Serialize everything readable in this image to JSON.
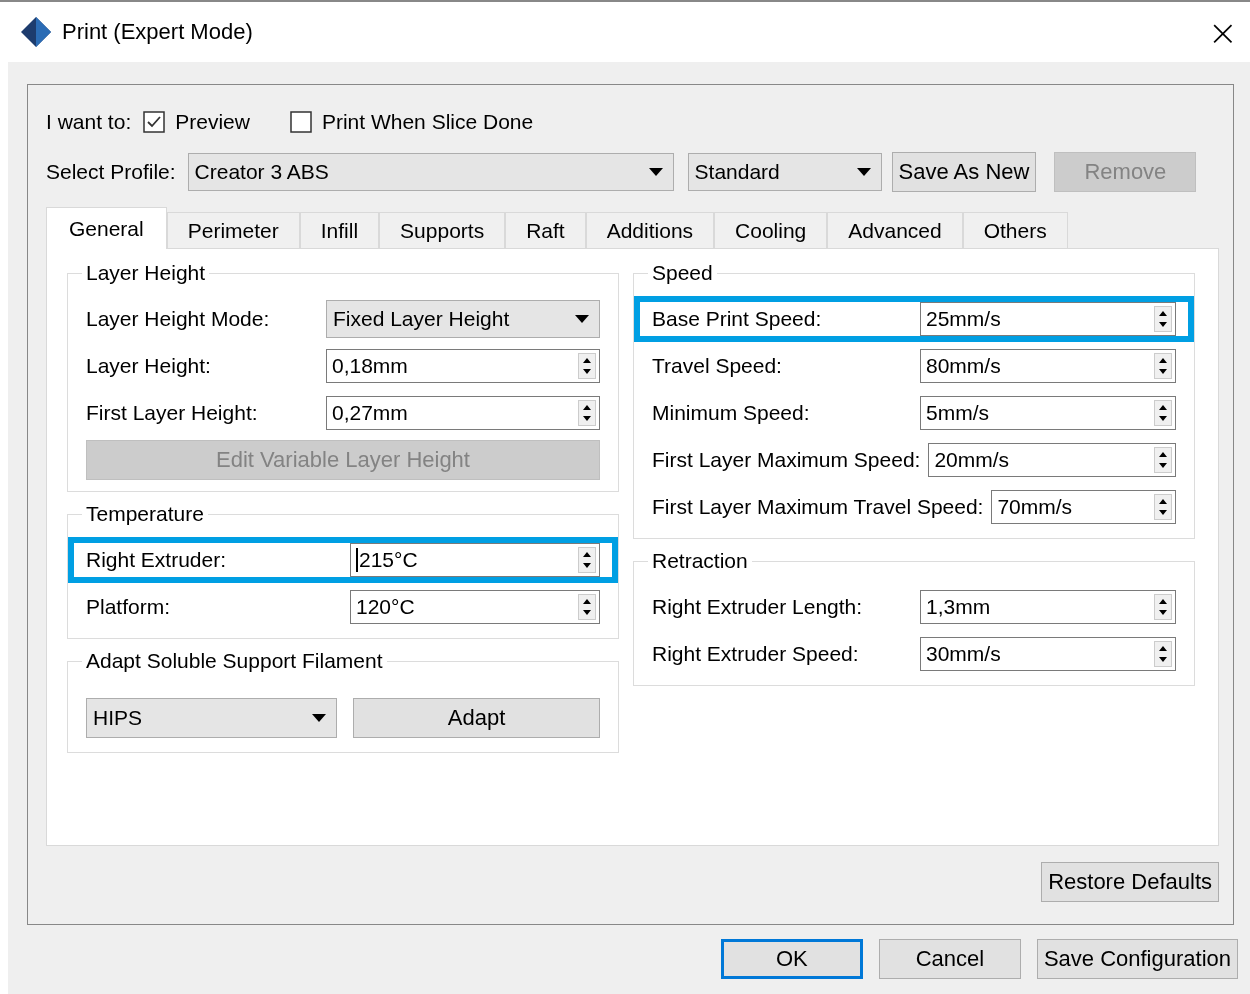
{
  "window": {
    "title": "Print (Expert Mode)",
    "close": "×"
  },
  "intent": {
    "label": "I want to:",
    "options": [
      {
        "label": "Preview",
        "checked": true
      },
      {
        "label": "Print When Slice Done",
        "checked": false
      }
    ]
  },
  "profile": {
    "label": "Select Profile:",
    "profile_value": "Creator 3 ABS",
    "quality_value": "Standard",
    "buttons": [
      {
        "label": "Save As New",
        "disabled": false
      },
      {
        "label": "Remove",
        "disabled": true
      }
    ]
  },
  "tabs": [
    {
      "label": "General",
      "selected": true
    },
    {
      "label": "Perimeter",
      "selected": false
    },
    {
      "label": "Infill",
      "selected": false
    },
    {
      "label": "Supports",
      "selected": false
    },
    {
      "label": "Raft",
      "selected": false
    },
    {
      "label": "Additions",
      "selected": false
    },
    {
      "label": "Cooling",
      "selected": false
    },
    {
      "label": "Advanced",
      "selected": false
    },
    {
      "label": "Others",
      "selected": false
    }
  ],
  "columns": [
    [
      {
        "title": "Layer Height",
        "rows": [
          {
            "kind": "dropdown",
            "label": "Layer Height Mode:",
            "value": "Fixed Layer Height",
            "highlighted": false
          },
          {
            "kind": "spin",
            "label": "Layer Height:",
            "value": "0,18mm",
            "highlighted": false
          },
          {
            "kind": "spin",
            "label": "First Layer Height:",
            "value": "0,27mm",
            "highlighted": false
          },
          {
            "kind": "button",
            "label": "Edit Variable Layer Height",
            "disabled": true
          }
        ]
      },
      {
        "title": "Temperature",
        "rows": [
          {
            "kind": "spin",
            "label": "Right Extruder:",
            "value": "215°C",
            "highlighted": true,
            "focused": true
          },
          {
            "kind": "spin",
            "label": "Platform:",
            "value": "120°C",
            "highlighted": false
          }
        ]
      },
      {
        "title": "Adapt Soluble Support Filament",
        "rows": [
          {
            "kind": "pair",
            "value": "HIPS",
            "button": "Adapt"
          }
        ]
      }
    ],
    [
      {
        "title": "Speed",
        "rows": [
          {
            "kind": "spin",
            "label": "Base Print Speed:",
            "value": "25mm/s",
            "highlighted": true
          },
          {
            "kind": "spin",
            "label": "Travel Speed:",
            "value": "80mm/s",
            "highlighted": false
          },
          {
            "kind": "spin",
            "label": "Minimum Speed:",
            "value": "5mm/s",
            "highlighted": false
          },
          {
            "kind": "spin",
            "label": "First Layer Maximum Speed:",
            "value": "20mm/s",
            "highlighted": false
          },
          {
            "kind": "spin",
            "label": "First Layer Maximum Travel Speed:",
            "value": "70mm/s",
            "highlighted": false
          }
        ]
      },
      {
        "title": "Retraction",
        "rows": [
          {
            "kind": "spin",
            "label": "Right Extruder Length:",
            "value": "1,3mm",
            "highlighted": false
          },
          {
            "kind": "spin",
            "label": "Right Extruder Speed:",
            "value": "30mm/s",
            "highlighted": false
          }
        ]
      }
    ]
  ],
  "restore_button": "Restore Defaults",
  "footer_buttons": [
    {
      "label": "OK",
      "default": true
    },
    {
      "label": "Cancel",
      "default": false
    },
    {
      "label": "Save Configuration",
      "default": false
    }
  ]
}
